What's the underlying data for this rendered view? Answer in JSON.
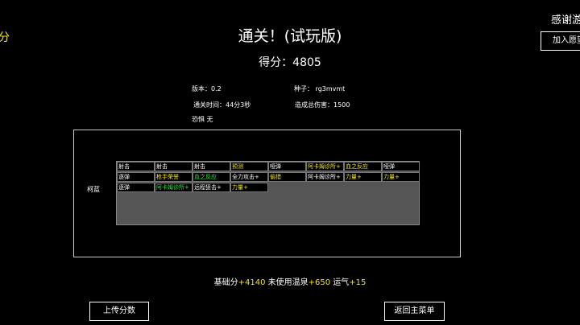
{
  "left_fragment": "分",
  "title": "通关！(试玩版)",
  "score": {
    "label": "得分：",
    "value": "4805"
  },
  "top_right": {
    "thanks": "感谢游",
    "join_button": "加入愿望"
  },
  "info": {
    "version": "版本：0.2",
    "seed": "种子：  rg3mvmt",
    "clear_time": "通关时间：44分3秒",
    "total_damage": "造成总伤害：1500",
    "fear": "恐惧 无"
  },
  "character": {
    "name": "柯蓝"
  },
  "cards": [
    [
      {
        "text": "射击",
        "color": "white"
      },
      {
        "text": "射击",
        "color": "white"
      },
      {
        "text": "射击",
        "color": "white"
      },
      {
        "text": "预测",
        "color": "yellow"
      },
      {
        "text": "哑弹",
        "color": "white"
      },
      {
        "text": "阿卡姆诊所+",
        "color": "yellow"
      },
      {
        "text": "血之反应",
        "color": "yellow"
      },
      {
        "text": "哑弹",
        "color": "white"
      }
    ],
    [
      {
        "text": "逐弹",
        "color": "white"
      },
      {
        "text": "枪手荣誉",
        "color": "yellow"
      },
      {
        "text": "血之反应",
        "color": "green"
      },
      {
        "text": "全力攻击+",
        "color": "white"
      },
      {
        "text": "偷猎",
        "color": "yellow"
      },
      {
        "text": "阿卡姆诊所+",
        "color": "white"
      },
      {
        "text": "力量+",
        "color": "yellow"
      },
      {
        "text": "力量+",
        "color": "yellow"
      }
    ],
    [
      {
        "text": "逐弹",
        "color": "white"
      },
      {
        "text": "阿卡姆诊所+",
        "color": "green"
      },
      {
        "text": "远程狙击+",
        "color": "white"
      },
      {
        "text": "力量+",
        "color": "yellow"
      }
    ]
  ],
  "summary": {
    "base_label": "基础分",
    "base_value": "+4140",
    "spring_label": " 未使用温泉",
    "spring_value": "+650",
    "luck_label": " 运气",
    "luck_value": "+15"
  },
  "buttons": {
    "upload": "上传分数",
    "return": "返回主菜单"
  }
}
